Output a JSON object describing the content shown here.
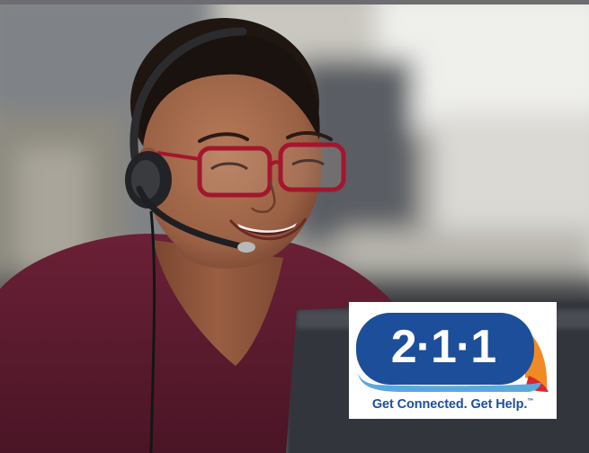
{
  "logo": {
    "number": "2·1·1",
    "tagline": "Get Connected. Get Help.",
    "trademark": "™",
    "colors": {
      "bubble": "#1d4e9a",
      "accent_orange": "#f08a24",
      "accent_red": "#d8262f",
      "accent_light_blue": "#5aa9dd",
      "text": "#1e4f9c"
    }
  },
  "photo": {
    "icons": [
      "headset-icon",
      "eyeglasses-icon"
    ]
  }
}
